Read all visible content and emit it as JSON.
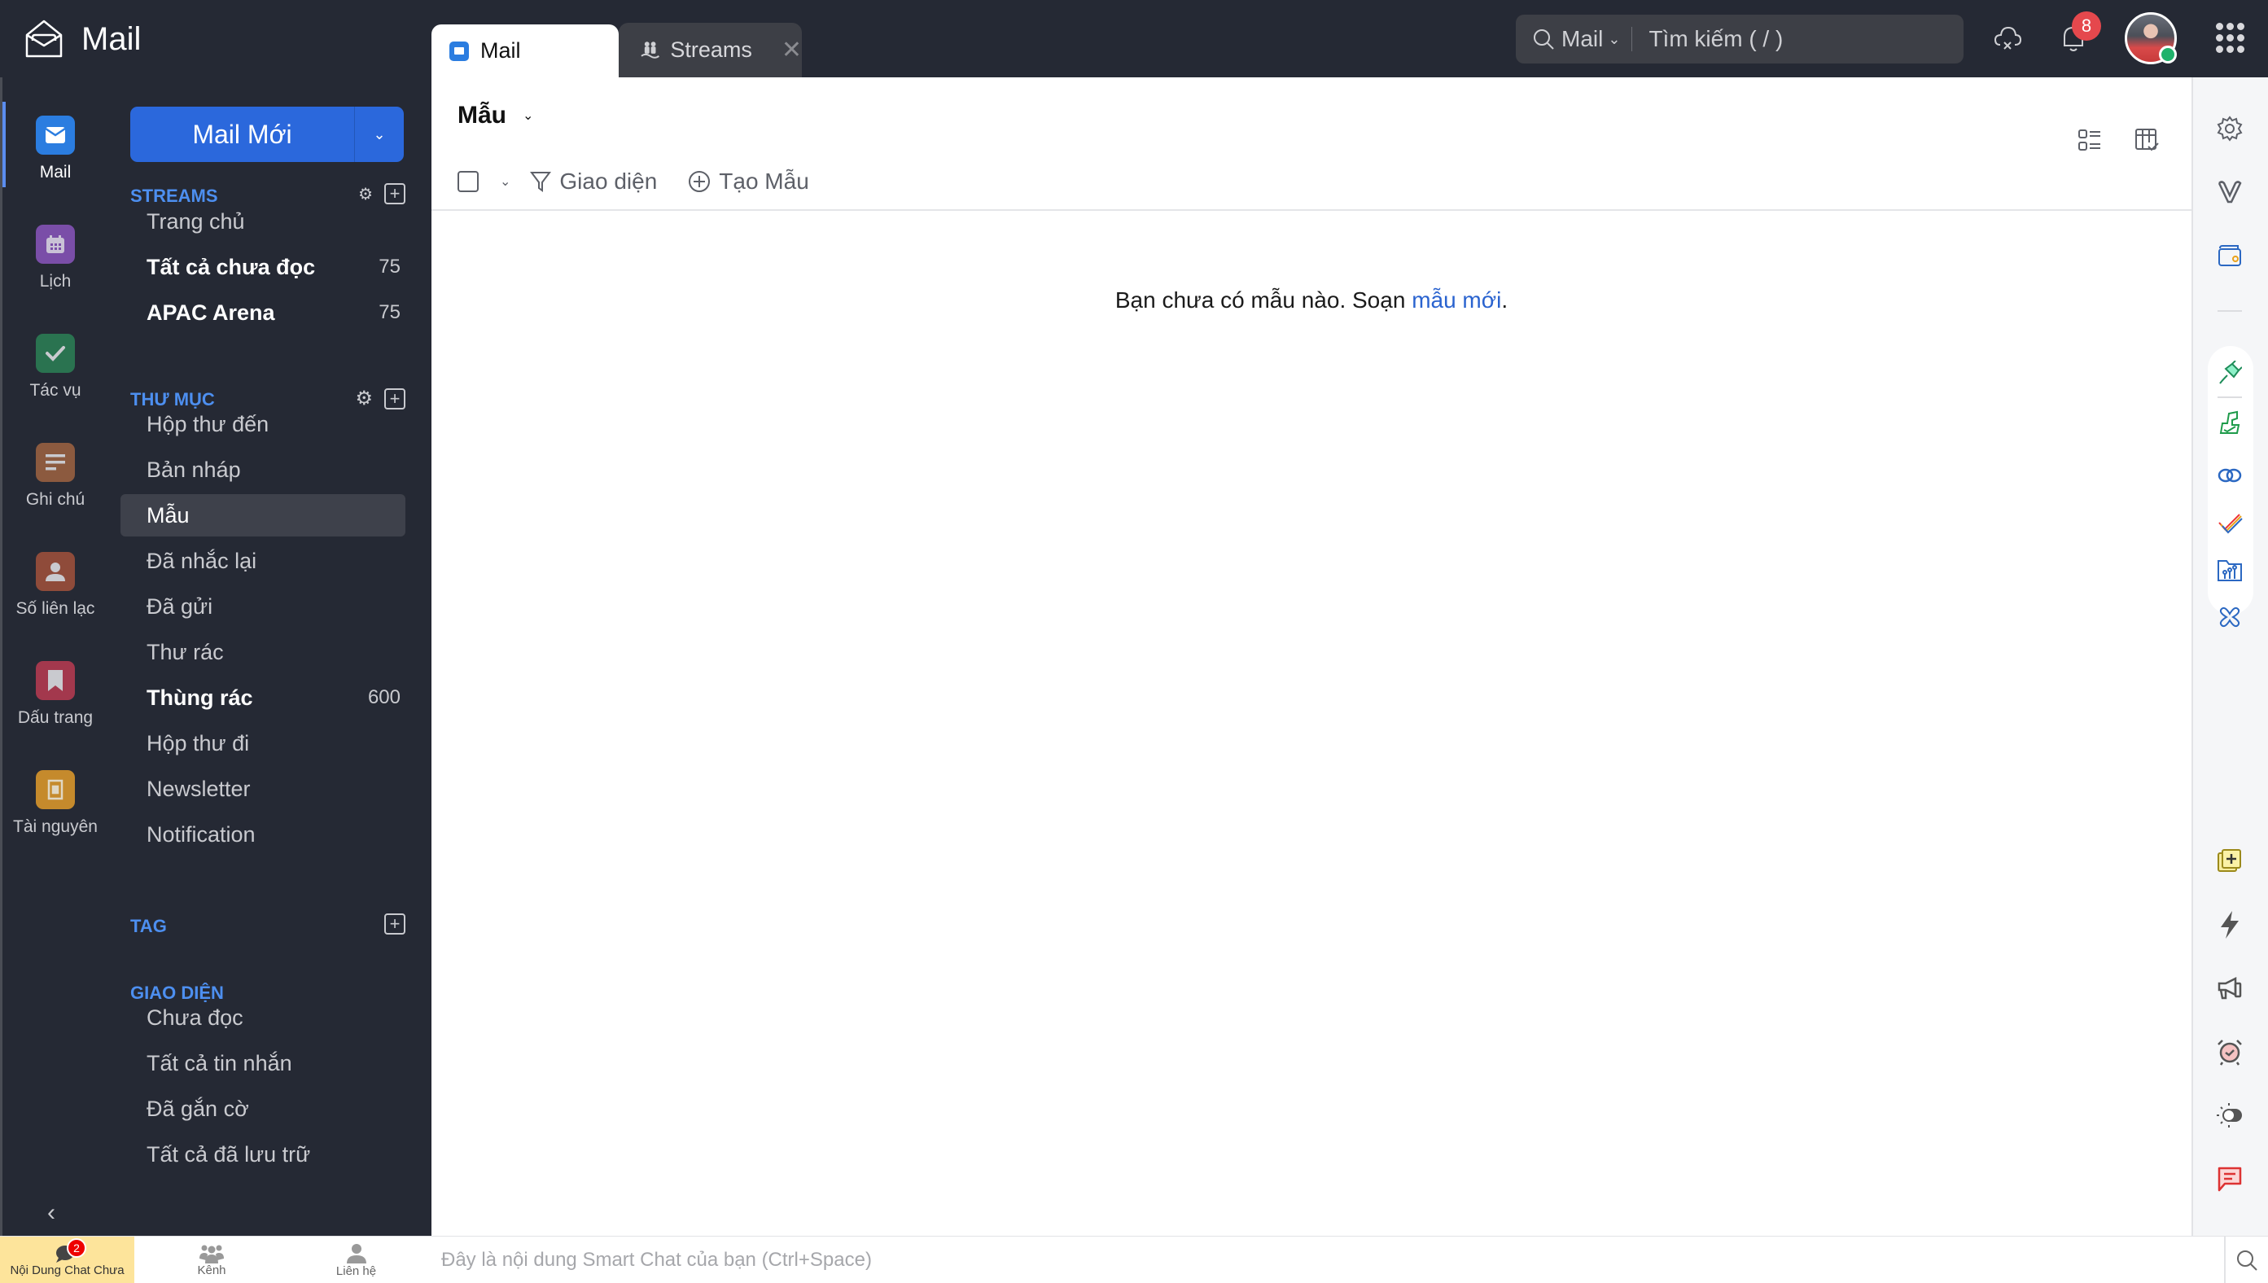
{
  "app": {
    "title": "Mail",
    "icon": "open-envelope-icon"
  },
  "tabs": [
    {
      "label": "Mail",
      "icon": "mail-icon",
      "active": true
    },
    {
      "label": "Streams",
      "icon": "streams-icon",
      "active": false,
      "close_icon": "close-icon",
      "close": "✕"
    }
  ],
  "search": {
    "scope": "Mail",
    "placeholder": "Tìm kiếm ( / )"
  },
  "topbar": {
    "notifications_count": "8",
    "icons": [
      "cloud-sync-icon",
      "bell-icon",
      "avatar",
      "apps-grid-icon"
    ]
  },
  "rail": {
    "items": [
      {
        "label": "Mail",
        "icon": "mail-icon",
        "color": "#2b7de0",
        "active": true
      },
      {
        "label": "Lịch",
        "icon": "calendar-icon",
        "color": "#7a4ea8"
      },
      {
        "label": "Tác vụ",
        "icon": "check-icon",
        "color": "#2a7350"
      },
      {
        "label": "Ghi chú",
        "icon": "notes-icon",
        "color": "#8c5a3f"
      },
      {
        "label": "Số liên lạc",
        "icon": "contact-icon",
        "color": "#8f4b3a"
      },
      {
        "label": "Dấu trang",
        "icon": "bookmark-icon",
        "color": "#a3384d"
      },
      {
        "label": "Tài nguyên",
        "icon": "resource-icon",
        "color": "#c58a2c"
      }
    ],
    "collapse": "‹"
  },
  "panel": {
    "compose_label": "Mail Mới",
    "compose_arrow": "⌄",
    "streams": {
      "heading": "STREAMS",
      "items": [
        {
          "label": "Trang chủ",
          "count": "",
          "bold": false
        },
        {
          "label": "Tất cả chưa đọc",
          "count": "75",
          "bold": true
        },
        {
          "label": "APAC Arena",
          "count": "75",
          "bold": true
        }
      ]
    },
    "folders": {
      "heading": "THƯ MỤC",
      "items": [
        {
          "label": "Hộp thư đến",
          "count": ""
        },
        {
          "label": "Bản nháp",
          "count": ""
        },
        {
          "label": "Mẫu",
          "count": "",
          "selected": true
        },
        {
          "label": "Đã nhắc lại",
          "count": ""
        },
        {
          "label": "Đã gửi",
          "count": ""
        },
        {
          "label": "Thư rác",
          "count": ""
        },
        {
          "label": "Thùng rác",
          "count": "600",
          "bold": true
        },
        {
          "label": "Hộp thư đi",
          "count": ""
        },
        {
          "label": "Newsletter",
          "count": ""
        },
        {
          "label": "Notification",
          "count": ""
        }
      ]
    },
    "tags": {
      "heading": "TAG"
    },
    "views": {
      "heading": "GIAO DIỆN",
      "items": [
        {
          "label": "Chưa đọc"
        },
        {
          "label": "Tất cả tin nhắn"
        },
        {
          "label": "Đã gắn cờ"
        },
        {
          "label": "Tất cả đã lưu trữ"
        }
      ]
    }
  },
  "main": {
    "title": "Mẫu",
    "title_chevron": "⌄",
    "toolbar": {
      "select_chevron": "⌄",
      "filter_label": "Giao diện",
      "create_label": "Tạo Mẫu"
    },
    "empty_message": "Bạn chưa có mẫu nào. Soạn ",
    "empty_link": "mẫu mới",
    "empty_suffix": "."
  },
  "right_rail": {
    "icons": [
      "settings-icon",
      "attachment-icon",
      "wallet-icon",
      "plug-icon",
      "sign-icon",
      "link-icon",
      "checklist-icon",
      "workdrive-icon",
      "flower-icon",
      "new-note-icon",
      "lightning-icon",
      "megaphone-icon",
      "alarm-icon",
      "theme-toggle-icon",
      "comment-icon"
    ]
  },
  "bottom": {
    "tabs": [
      {
        "label": "Nội Dung Chat Chưa",
        "icon": "chat-icon",
        "badge": "2",
        "active": true
      },
      {
        "label": "Kênh",
        "icon": "channels-icon"
      },
      {
        "label": "Liên hệ",
        "icon": "contact-icon"
      }
    ],
    "chat_placeholder": "Đây là nội dung Smart Chat của bạn (Ctrl+Space)"
  }
}
